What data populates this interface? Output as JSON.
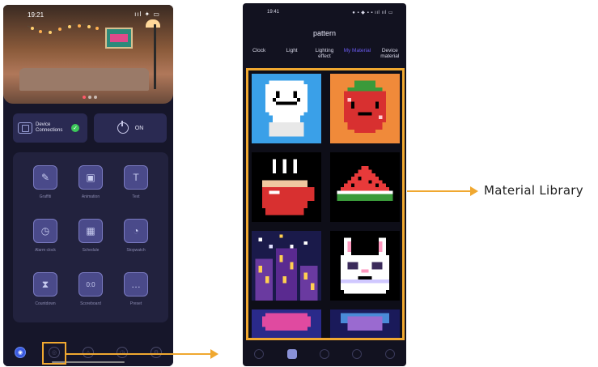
{
  "left_phone": {
    "status_time": "19:21",
    "status_icons": "ııl ✦ ▭",
    "device_connections_label": "Device Connections",
    "power_label": "ON",
    "tools": [
      {
        "label": "Graffiti",
        "icon": "brush-icon"
      },
      {
        "label": "Animation",
        "icon": "animation-icon"
      },
      {
        "label": "Text",
        "icon": "text-icon"
      },
      {
        "label": "Alarm clock",
        "icon": "alarm-clock-icon"
      },
      {
        "label": "Schedule",
        "icon": "calendar-icon"
      },
      {
        "label": "Stopwatch",
        "icon": "stopwatch-icon"
      },
      {
        "label": "Countdown",
        "icon": "hourglass-icon"
      },
      {
        "label": "Scoreboard",
        "icon": "scoreboard-icon"
      },
      {
        "label": "Preset",
        "icon": "chat-bubble-icon"
      }
    ]
  },
  "right_phone": {
    "status_time": "19:41",
    "status_icons": "● ▪ ◆ ▪ ▪ ııl ııl ▭",
    "page_title": "pattern",
    "tabs": [
      {
        "label": "Clock",
        "active": false
      },
      {
        "label": "Light",
        "active": false
      },
      {
        "label": "Lighting effect",
        "active": false
      },
      {
        "label": "My Material",
        "active": true
      },
      {
        "label": "Device material",
        "active": false
      }
    ]
  },
  "annotation": {
    "callout_label": "Material Library",
    "highlight_color": "#f0a830"
  }
}
